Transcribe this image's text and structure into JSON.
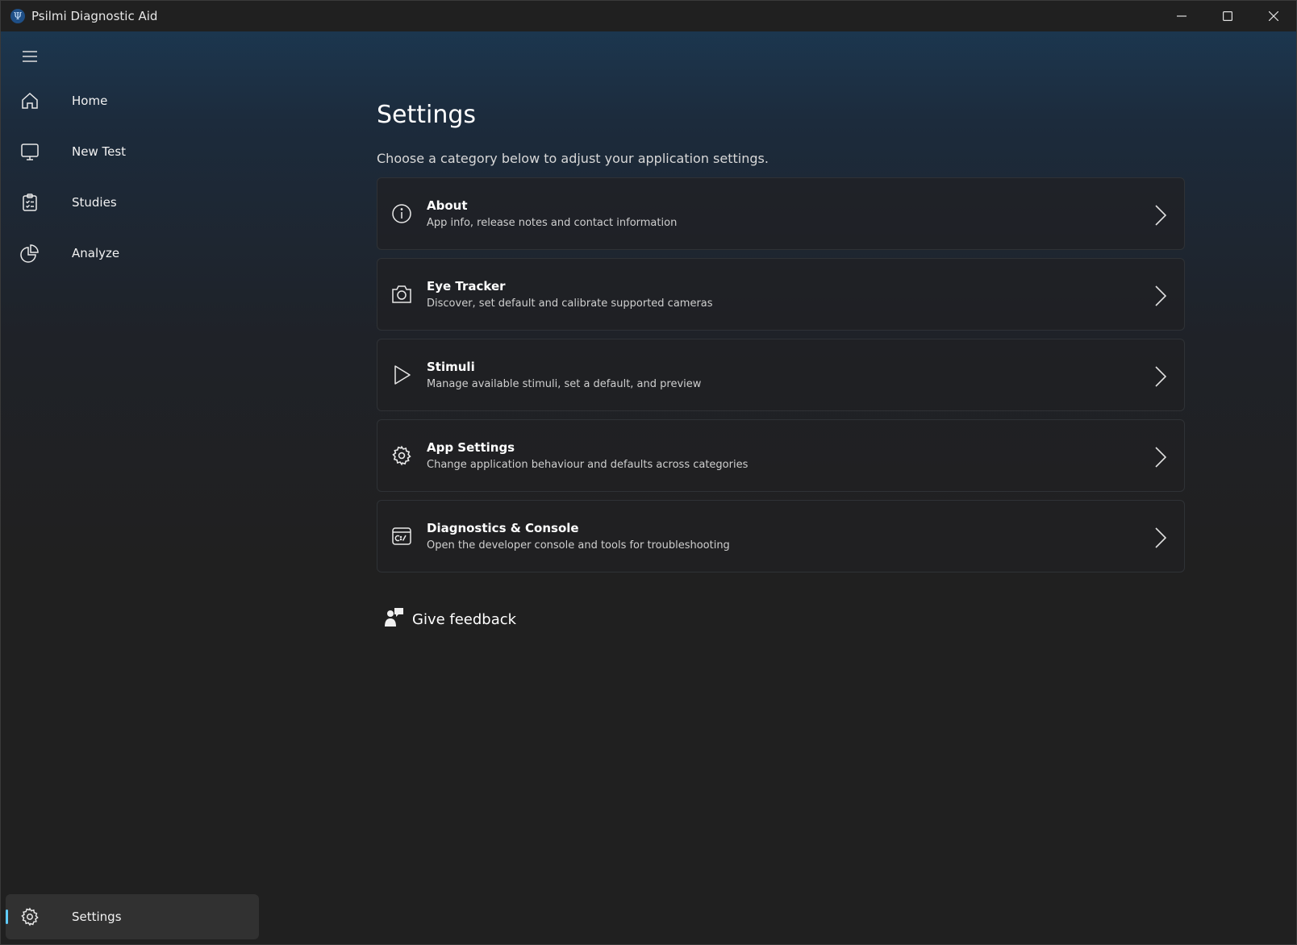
{
  "window": {
    "title": "Psilmi Diagnostic Aid",
    "logo_glyph": "Ψ"
  },
  "sidebar": {
    "items": [
      {
        "label": "Home",
        "icon": "home-icon"
      },
      {
        "label": "New Test",
        "icon": "monitor-icon"
      },
      {
        "label": "Studies",
        "icon": "clipboard-icon"
      },
      {
        "label": "Analyze",
        "icon": "pie-chart-icon"
      }
    ],
    "footer": {
      "label": "Settings",
      "icon": "gear-icon",
      "selected": true
    }
  },
  "main": {
    "title": "Settings",
    "description": "Choose a category below to adjust your application settings.",
    "cards": [
      {
        "title": "About",
        "subtitle": "App info, release notes and contact information",
        "icon": "info-icon"
      },
      {
        "title": "Eye Tracker",
        "subtitle": "Discover, set default and calibrate supported cameras",
        "icon": "camera-icon"
      },
      {
        "title": "Stimuli",
        "subtitle": "Manage available stimuli, set a default, and preview",
        "icon": "play-icon"
      },
      {
        "title": "App Settings",
        "subtitle": "Change application behaviour and defaults across categories",
        "icon": "gear-icon"
      },
      {
        "title": "Diagnostics & Console",
        "subtitle": "Open the developer console and tools for troubleshooting",
        "icon": "console-icon"
      }
    ],
    "feedback_label": "Give feedback"
  },
  "colors": {
    "accent": "#60cdff",
    "background": "#202020"
  }
}
